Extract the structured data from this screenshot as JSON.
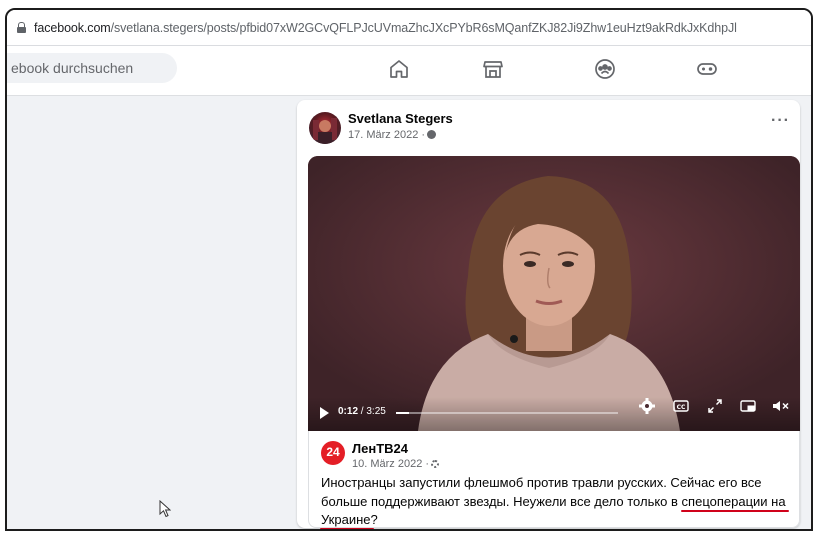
{
  "browser": {
    "url_host": "facebook.com",
    "url_path": "/svetlana.stegers/posts/pfbid07xW2GCvQFLPJcUVmaZhcJXcPYbR6sMQanfZKJ82Ji9Zhw1euHzt9akRdkJxKdhpJl"
  },
  "nav": {
    "search_text": "ebook durchsuchen",
    "icons": [
      "home-icon",
      "marketplace-icon",
      "groups-icon",
      "gaming-icon"
    ]
  },
  "post": {
    "author": "Svetlana Stegers",
    "date": "17. März 2022 ·",
    "more": "···"
  },
  "video": {
    "current_time": "0:12",
    "duration": " / 3:25",
    "progress_fraction": 0.06
  },
  "shared": {
    "logo_text": "24",
    "author": "ЛенТВ24",
    "date": "10. März 2022 ·",
    "text_part1": "Иностранцы запустили флешмоб против травли русских. Сейчас его все больше поддерживают звезды. Неужели все дело только в ",
    "text_highlight1": "спецоперации на",
    "text_space": " ",
    "text_highlight2": "Украине",
    "text_end": "?"
  },
  "colors": {
    "fb_bg": "#f0f2f5",
    "underline_red": "#d0021b",
    "logo_red": "#e41e26"
  }
}
